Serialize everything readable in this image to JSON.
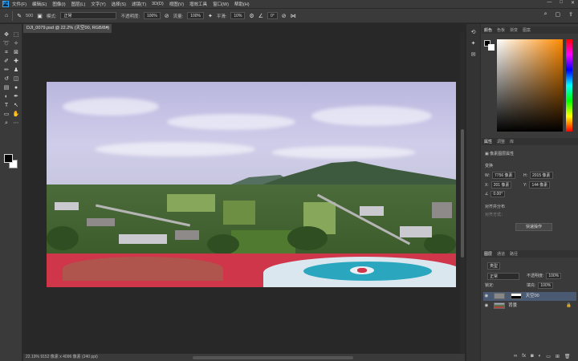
{
  "menubar": {
    "logo": "Ps",
    "items": [
      "文件(F)",
      "编辑(E)",
      "图像(I)",
      "图层(L)",
      "文字(Y)",
      "选择(S)",
      "滤镜(T)",
      "3D(D)",
      "视图(V)",
      "增效工具",
      "窗口(W)",
      "帮助(H)"
    ],
    "win": [
      "—",
      "□",
      "✕"
    ]
  },
  "options": {
    "brush_size": "500",
    "mode_label": "模式:",
    "mode_value": "正常",
    "opacity_label": "不透明度:",
    "opacity_value": "100%",
    "flow_label": "流量:",
    "flow_value": "100%",
    "smooth_label": "平滑:",
    "smooth_value": "10%",
    "angle_value": "0°"
  },
  "document": {
    "tab_title": "DJI_0079.psd @ 22.2% (天空00, RGB/8#)",
    "close": "×",
    "status": "22.19%   9152 像素 x 4096 像素 (240 ppi)"
  },
  "right_panel": {
    "color_tabs": [
      "颜色",
      "色板",
      "渐变",
      "图案"
    ],
    "props_tabs": [
      "属性",
      "调整",
      "库"
    ],
    "pixel_layer": "像素图层属性",
    "transform_label": "变换",
    "w_label": "W:",
    "w_value": "7756 像素",
    "h_label": "H:",
    "h_value": "2015 像素",
    "x_label": "X:",
    "x_value": "201 像素",
    "y_label": "Y:",
    "y_value": "144 像素",
    "angle": "0.00°",
    "align_label": "对齐并分布",
    "align_sub": "对齐方式：",
    "quick_btn": "快速操作",
    "layers_tabs": [
      "图层",
      "通道",
      "路径"
    ],
    "kind": "类型",
    "blend": "正常",
    "opacity_label": "不透明度:",
    "opacity_value": "100%",
    "lock_label": "锁定:",
    "fill_label": "填充:",
    "fill_value": "100%",
    "layers": [
      {
        "name": "天空00",
        "selected": true
      },
      {
        "name": "背景",
        "selected": false
      }
    ]
  }
}
